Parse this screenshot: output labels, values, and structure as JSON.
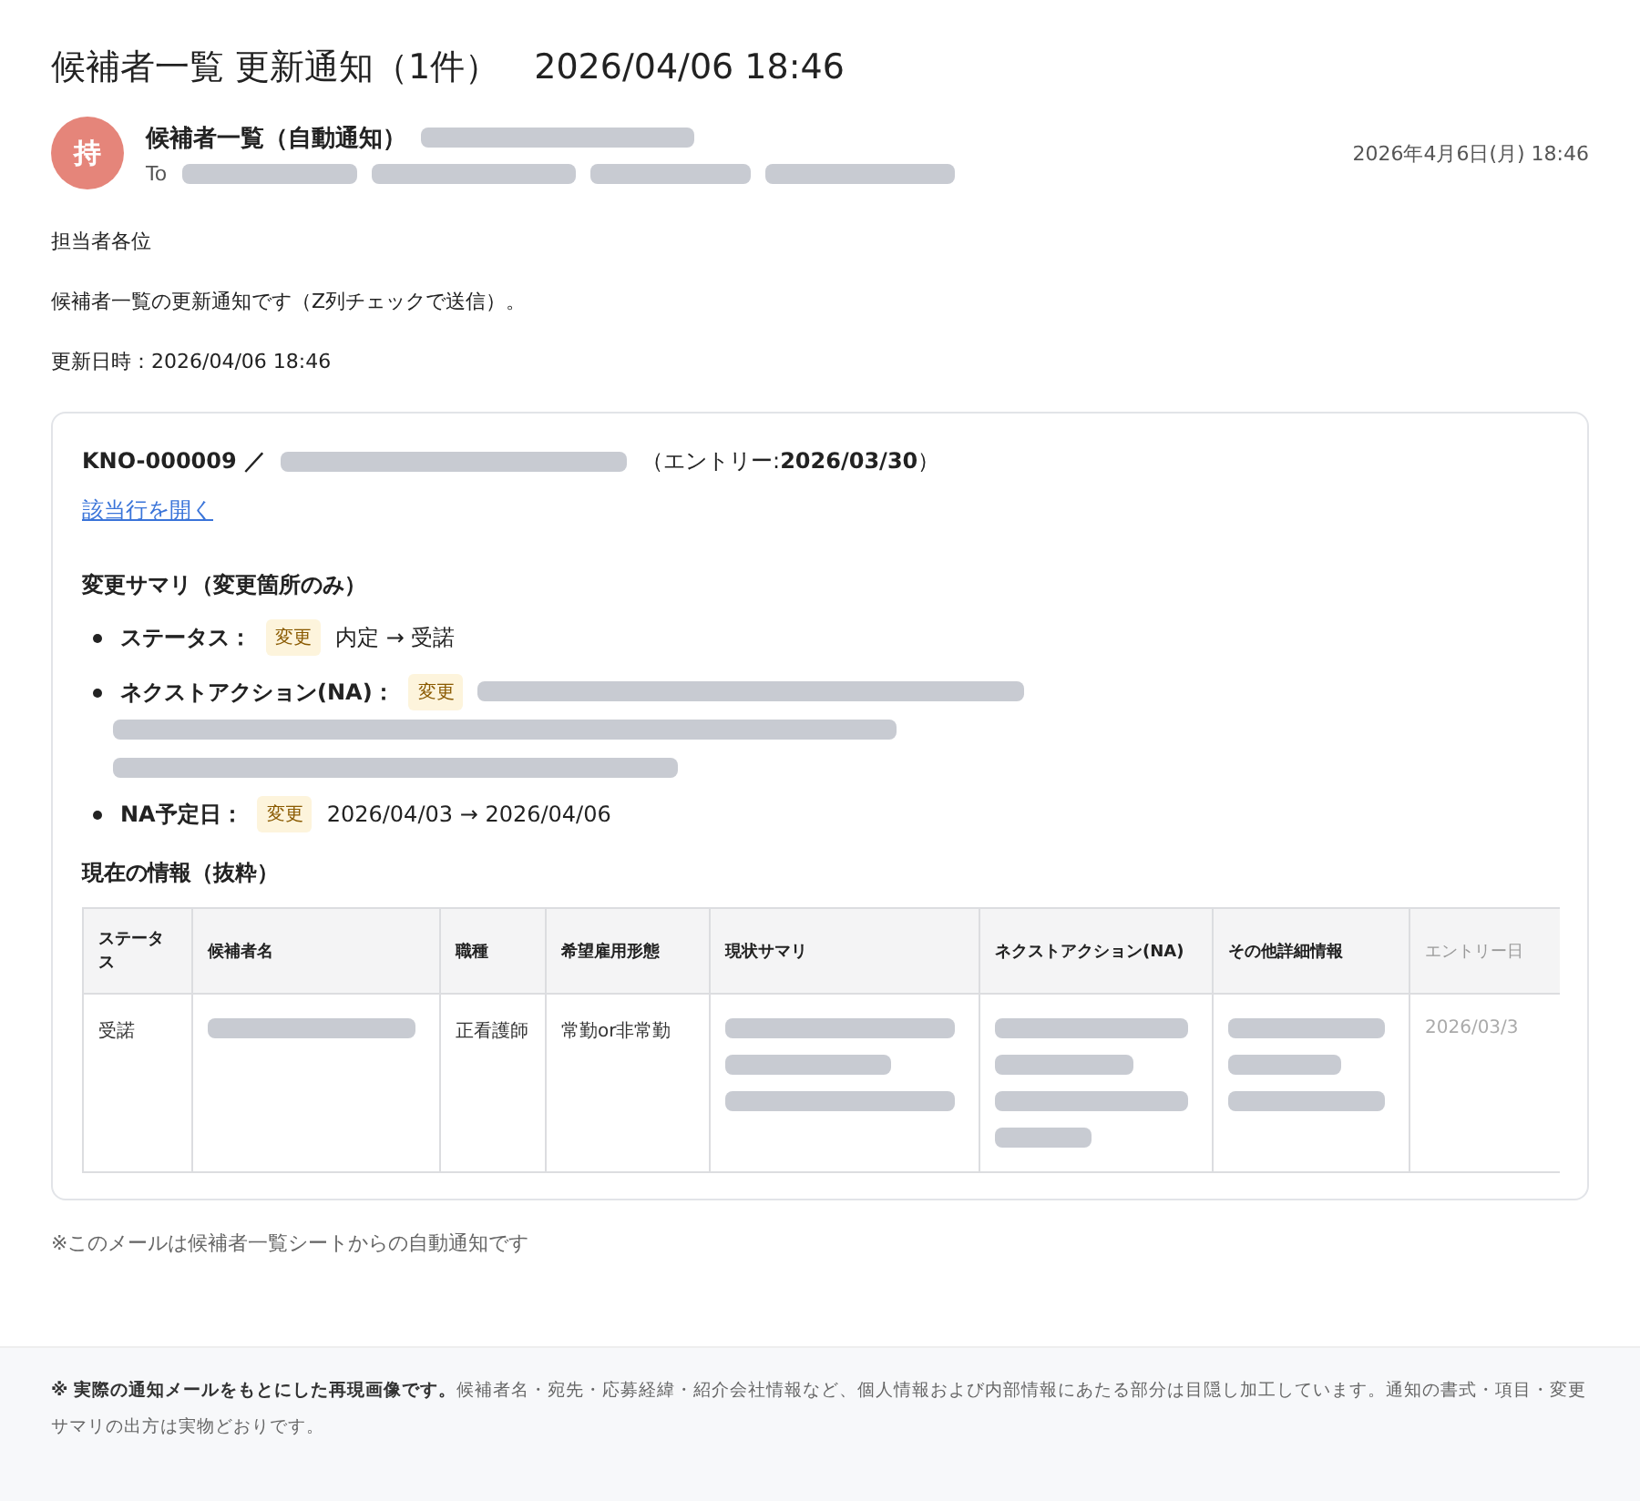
{
  "subject": "候補者一覧 更新通知（1件）　2026/04/06 18:46",
  "sender": {
    "avatar": "持",
    "name": "候補者一覧（自動通知）",
    "to_label": "To",
    "date": "2026年4月6日(月) 18:46"
  },
  "body": [
    "担当者各位",
    "候補者一覧の更新通知です（Z列チェックで送信）。",
    "更新日時：2026/04/06 18:46"
  ],
  "card": {
    "id": "KNO-000009 ／",
    "entry": "（エントリー:**2026/03/30**）",
    "link": "該当行を開く",
    "summary_title": "変更サマリ（変更箇所のみ）",
    "changes": [
      {
        "label": "ステータス：",
        "tag": "変更",
        "kind": "text",
        "value": "内定 → 受諾"
      },
      {
        "label": "ネクストアクション(NA)：",
        "tag": "変更",
        "kind": "redacted"
      },
      {
        "label": "NA予定日：",
        "tag": "変更",
        "kind": "text",
        "value": "2026/04/03 → 2026/04/06"
      }
    ],
    "info_title": "現在の情報（抜粋）",
    "table": {
      "columns": [
        "ステータス",
        "候補者名",
        "職種",
        "希望雇用形態",
        "現状サマリ",
        "ネクストアクション(NA)",
        "その他詳細情報",
        "エントリー日"
      ],
      "rows": [
        [
          {
            "kind": "text",
            "text": "受諾"
          },
          {
            "kind": "redacted"
          },
          {
            "kind": "text",
            "text": "正看護師"
          },
          {
            "kind": "text",
            "text": "常勤or非常勤"
          },
          {
            "kind": "redacted"
          },
          {
            "kind": "redacted"
          },
          {
            "kind": "redacted"
          },
          {
            "kind": "faded",
            "text": "2026/03/3"
          }
        ]
      ]
    }
  },
  "footer_note": "※このメールは候補者一覧シートからの自動通知です",
  "disclaimer": "**※ 実際の通知メールをもとにした再現画像です。**候補者名・宛先・応募経緯・紹介会社情報など、個人情報および内部情報にあたる部分は目隠し加工しています。通知の書式・項目・変更サマリの出方は実物どおりです。"
}
